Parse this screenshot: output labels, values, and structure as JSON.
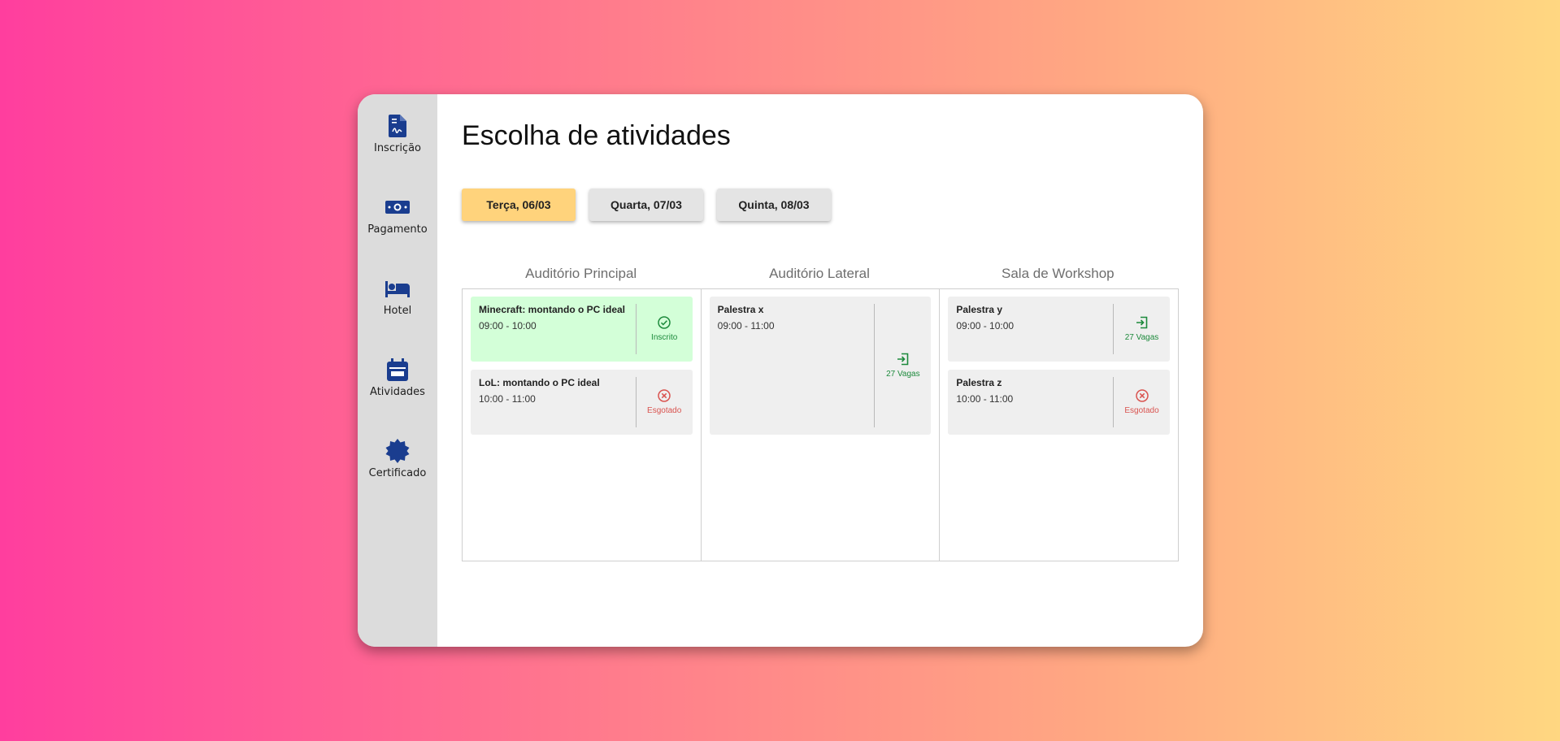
{
  "sidebar": {
    "items": [
      {
        "label": "Inscrição",
        "icon": "registration-document-icon"
      },
      {
        "label": "Pagamento",
        "icon": "money-icon"
      },
      {
        "label": "Hotel",
        "icon": "bed-icon"
      },
      {
        "label": "Atividades",
        "icon": "calendar-icon"
      },
      {
        "label": "Certificado",
        "icon": "badge-icon"
      }
    ]
  },
  "page": {
    "title": "Escolha de atividades"
  },
  "days": [
    {
      "label": "Terça, 06/03",
      "active": true
    },
    {
      "label": "Quarta, 07/03",
      "active": false
    },
    {
      "label": "Quinta, 08/03",
      "active": false
    }
  ],
  "rooms": [
    {
      "name": "Auditório Principal",
      "activities": [
        {
          "name": "Minecraft: montando o PC ideal",
          "time": "09:00 - 10:00",
          "status": "Inscrito",
          "status_icon": "check-circle-icon"
        },
        {
          "name": "LoL: montando o PC ideal",
          "time": "10:00 - 11:00",
          "status": "Esgotado",
          "status_icon": "x-circle-icon"
        }
      ]
    },
    {
      "name": "Auditório Lateral",
      "activities": [
        {
          "name": "Palestra x",
          "time": "09:00 - 11:00",
          "status": "27 Vagas",
          "status_icon": "enter-icon"
        }
      ]
    },
    {
      "name": "Sala de Workshop",
      "activities": [
        {
          "name": "Palestra y",
          "time": "09:00 - 10:00",
          "status": "27 Vagas",
          "status_icon": "enter-icon"
        },
        {
          "name": "Palestra z",
          "time": "10:00 - 11:00",
          "status": "Esgotado",
          "status_icon": "x-circle-icon"
        }
      ]
    }
  ],
  "colors": {
    "accent_day": "#FFD37C",
    "enrolled_bg": "#D3FFD8",
    "icon_blue": "#1A3D8F",
    "available_green": "#1d8a3c",
    "soldout_red": "#d9534f"
  }
}
